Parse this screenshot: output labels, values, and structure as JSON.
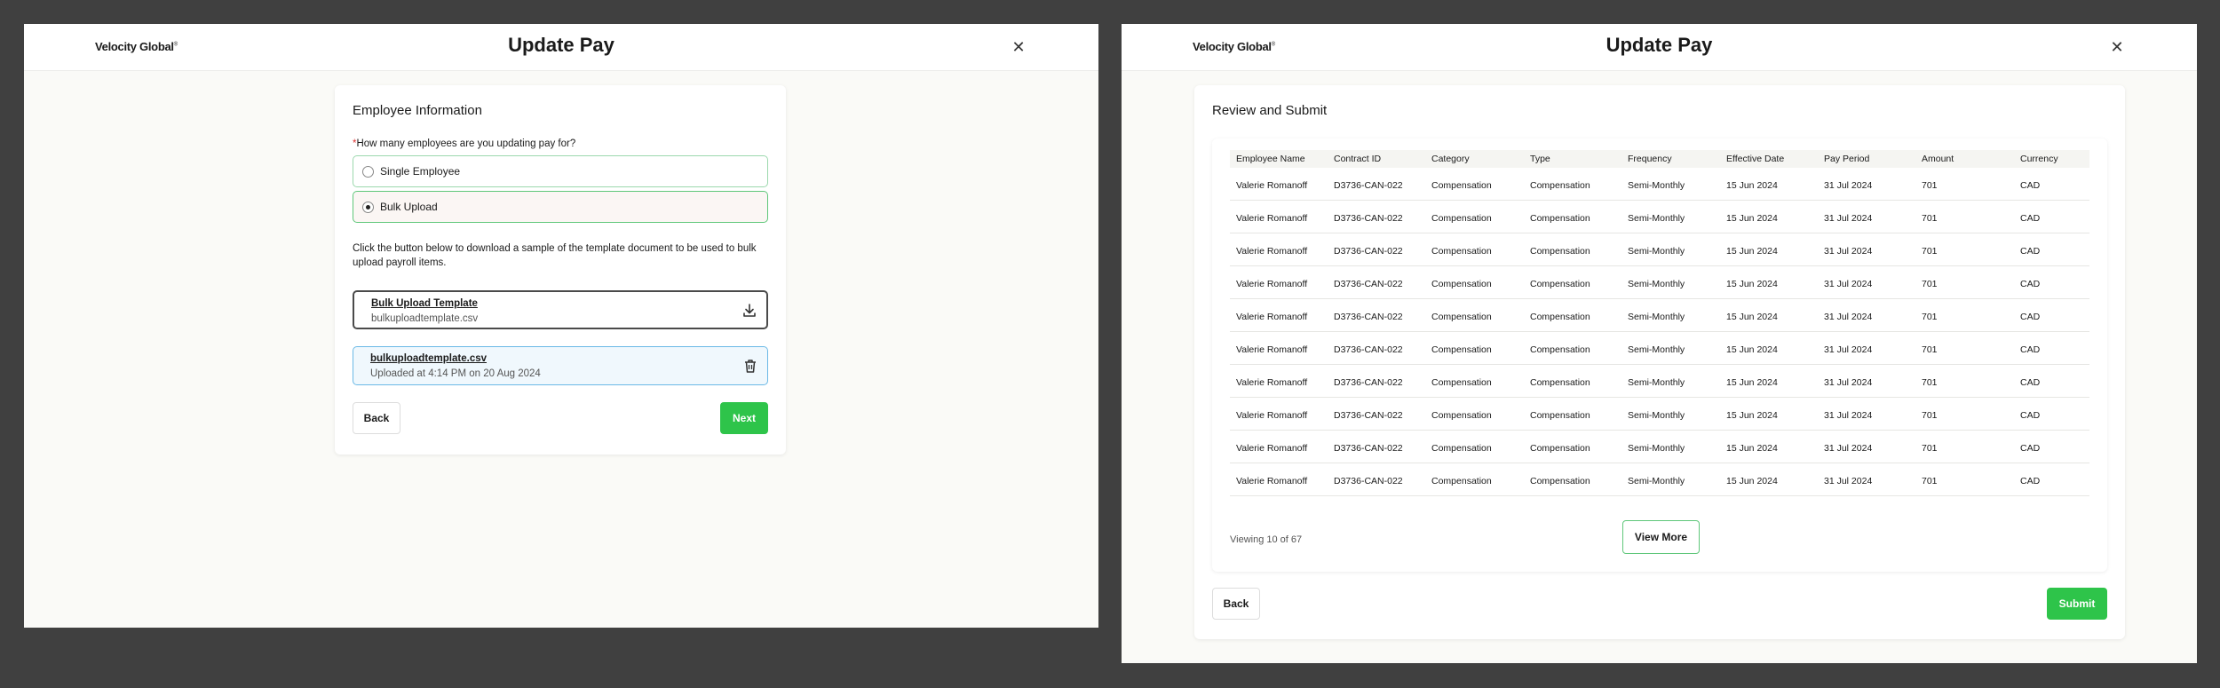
{
  "left_window": {
    "logo": "Velocity Global",
    "title": "Update Pay",
    "card_title": "Employee Information",
    "question_required_mark": "*",
    "question": "How many employees are you updating pay for?",
    "options": [
      {
        "label": "Single Employee",
        "selected": false
      },
      {
        "label": "Bulk Upload",
        "selected": true
      }
    ],
    "instructions": "Click the button below to download a sample of the template document to be used to bulk upload payroll items.",
    "template": {
      "title": "Bulk Upload Template",
      "filename": "bulkuploadtemplate.csv"
    },
    "uploaded": {
      "filename": "bulkuploadtemplate.csv",
      "status": "Uploaded at 4:14 PM on 20 Aug 2024"
    },
    "back_label": "Back",
    "next_label": "Next"
  },
  "right_window": {
    "logo": "Velocity Global",
    "title": "Update Pay",
    "card_title": "Review and Submit",
    "columns": [
      "Employee Name",
      "Contract ID",
      "Category",
      "Type",
      "Frequency",
      "Effective Date",
      "Pay Period",
      "Amount",
      "Currency"
    ],
    "rows": [
      [
        "Valerie Romanoff",
        "D3736-CAN-022",
        "Compensation",
        "Compensation",
        "Semi-Monthly",
        "15 Jun 2024",
        "31 Jul 2024",
        "701",
        "CAD"
      ],
      [
        "Valerie Romanoff",
        "D3736-CAN-022",
        "Compensation",
        "Compensation",
        "Semi-Monthly",
        "15 Jun 2024",
        "31 Jul 2024",
        "701",
        "CAD"
      ],
      [
        "Valerie Romanoff",
        "D3736-CAN-022",
        "Compensation",
        "Compensation",
        "Semi-Monthly",
        "15 Jun 2024",
        "31 Jul 2024",
        "701",
        "CAD"
      ],
      [
        "Valerie Romanoff",
        "D3736-CAN-022",
        "Compensation",
        "Compensation",
        "Semi-Monthly",
        "15 Jun 2024",
        "31 Jul 2024",
        "701",
        "CAD"
      ],
      [
        "Valerie Romanoff",
        "D3736-CAN-022",
        "Compensation",
        "Compensation",
        "Semi-Monthly",
        "15 Jun 2024",
        "31 Jul 2024",
        "701",
        "CAD"
      ],
      [
        "Valerie Romanoff",
        "D3736-CAN-022",
        "Compensation",
        "Compensation",
        "Semi-Monthly",
        "15 Jun 2024",
        "31 Jul 2024",
        "701",
        "CAD"
      ],
      [
        "Valerie Romanoff",
        "D3736-CAN-022",
        "Compensation",
        "Compensation",
        "Semi-Monthly",
        "15 Jun 2024",
        "31 Jul 2024",
        "701",
        "CAD"
      ],
      [
        "Valerie Romanoff",
        "D3736-CAN-022",
        "Compensation",
        "Compensation",
        "Semi-Monthly",
        "15 Jun 2024",
        "31 Jul 2024",
        "701",
        "CAD"
      ],
      [
        "Valerie Romanoff",
        "D3736-CAN-022",
        "Compensation",
        "Compensation",
        "Semi-Monthly",
        "15 Jun 2024",
        "31 Jul 2024",
        "701",
        "CAD"
      ],
      [
        "Valerie Romanoff",
        "D3736-CAN-022",
        "Compensation",
        "Compensation",
        "Semi-Monthly",
        "15 Jun 2024",
        "31 Jul 2024",
        "701",
        "CAD"
      ]
    ],
    "viewing": "Viewing 10 of 67",
    "view_more_label": "View More",
    "back_label": "Back",
    "submit_label": "Submit"
  },
  "icons": {
    "close": "close-icon",
    "download": "download-icon",
    "trash": "trash-icon"
  },
  "colors": {
    "accent_green": "#2ec44a",
    "selected_border": "#5fc77a",
    "upload_border": "#6bb9e6",
    "required": "#d33"
  }
}
